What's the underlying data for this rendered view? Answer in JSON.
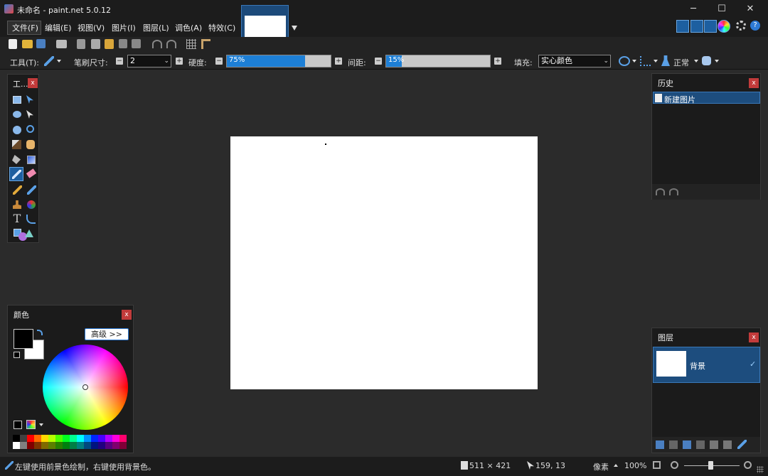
{
  "window": {
    "title": "未命名 - paint.net 5.0.12",
    "minimize_glyph": "─",
    "maximize_glyph": "☐",
    "close_glyph": "✕"
  },
  "menu": [
    "文件(F)",
    "编辑(E)",
    "视图(V)",
    "图片(I)",
    "图层(L)",
    "调色(A)",
    "特效(C)"
  ],
  "toolbar2": {
    "tool_label": "工具(T):",
    "brush_size_label": "笔刷尺寸:",
    "brush_size_value": "2",
    "hardness_label": "硬度:",
    "hardness_value": "75%",
    "hardness_fraction": 0.75,
    "spacing_label": "间距:",
    "spacing_value": "15%",
    "spacing_fraction": 0.15,
    "fill_label": "填充:",
    "fill_value": "实心颜色",
    "blend_mode": "正常"
  },
  "tools_panel": {
    "title": "工..."
  },
  "history_panel": {
    "title": "历史",
    "items": [
      "新建图片"
    ]
  },
  "colors_panel": {
    "title": "颜色",
    "advanced_button": "高级 >>",
    "primary_color": "#000000",
    "secondary_color": "#ffffff"
  },
  "layers_panel": {
    "title": "图层",
    "layers": [
      {
        "name": "背景",
        "visible": true
      }
    ]
  },
  "status": {
    "hint": "左键使用前景色绘制，右键使用背景色。",
    "image_size": "511 × 421",
    "cursor_pos": "159, 13",
    "units": "像素",
    "zoom": "100%"
  },
  "palette": {
    "row1": [
      "#000000",
      "#404040",
      "#ff0000",
      "#ff6a00",
      "#ffd800",
      "#b6ff00",
      "#4cff00",
      "#00ff21",
      "#00ff90",
      "#00ffff",
      "#0094ff",
      "#0026ff",
      "#4800ff",
      "#b200ff",
      "#ff00dc",
      "#ff006e"
    ],
    "row2": [
      "#ffffff",
      "#808080",
      "#7f0000",
      "#7f3300",
      "#7f6a00",
      "#5b7f00",
      "#267f00",
      "#007f0e",
      "#007f46",
      "#007f7f",
      "#004a7f",
      "#00137f",
      "#21007f",
      "#57007f",
      "#7f006e",
      "#7f0037"
    ]
  },
  "close_label": "x"
}
